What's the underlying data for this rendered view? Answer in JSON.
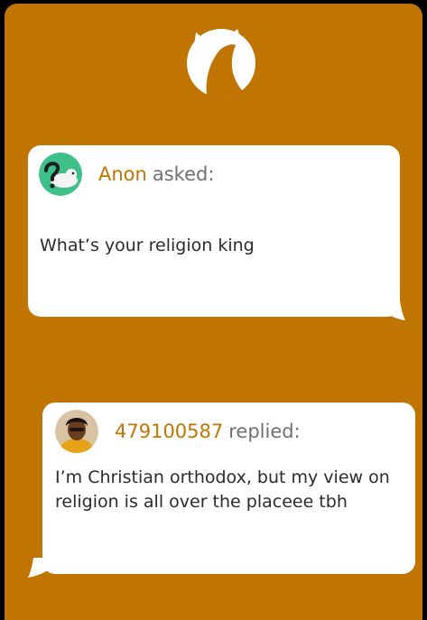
{
  "colors": {
    "background": "#c07402",
    "bubble": "#ffffff",
    "accent_name": "#c07402",
    "muted_text": "#707070",
    "body_text": "#2b2b2b"
  },
  "logo": {
    "icon": "fox-head-icon"
  },
  "question": {
    "author": "Anon",
    "verb": "asked:",
    "avatar_icon": "anonymous-mascot-icon",
    "text": "What’s your religion king"
  },
  "reply": {
    "author": "479100587",
    "verb": "replied:",
    "avatar_icon": "user-avatar",
    "text": "I’m Christian orthodox, but my view on religion is all over the placeee tbh"
  }
}
